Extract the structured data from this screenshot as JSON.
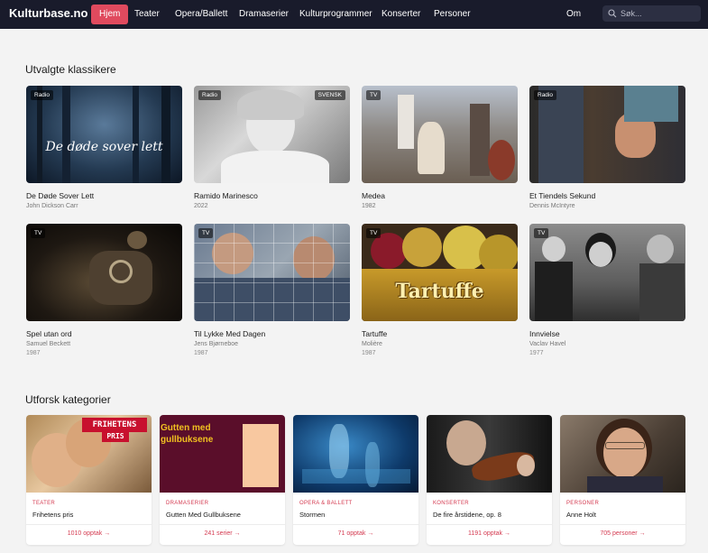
{
  "nav": {
    "brand": "Kulturbase.no",
    "items": [
      "Hjem",
      "Teater",
      "Opera/Ballett",
      "Dramaserier",
      "Kulturprogrammer",
      "Konserter",
      "Personer"
    ],
    "om": "Om",
    "search_placeholder": "Søk..."
  },
  "classics": {
    "heading": "Utvalgte klassikere",
    "items": [
      {
        "title": "De Døde Sover Lett",
        "sub": "John Dickson Carr",
        "year": "",
        "badge": "Radio",
        "badge2": "",
        "overlay": "De døde sover lett"
      },
      {
        "title": "Ramido Marinesco",
        "sub": "2022",
        "year": "",
        "badge": "Radio",
        "badge2": "SVENSK",
        "overlay": ""
      },
      {
        "title": "Medea",
        "sub": "1982",
        "year": "",
        "badge": "TV",
        "badge2": "",
        "overlay": ""
      },
      {
        "title": "Et Tiendels Sekund",
        "sub": "Dennis McIntyre",
        "year": "",
        "badge": "Radio",
        "badge2": "",
        "overlay": ""
      },
      {
        "title": "Spel utan ord",
        "sub": "Samuel Beckett",
        "year": "1987",
        "badge": "TV",
        "badge2": "",
        "overlay": ""
      },
      {
        "title": "Til Lykke Med Dagen",
        "sub": "Jens Bjørneboe",
        "year": "1987",
        "badge": "TV",
        "badge2": "",
        "overlay": ""
      },
      {
        "title": "Tartuffe",
        "sub": "Molière",
        "year": "1987",
        "badge": "TV",
        "badge2": "",
        "overlay": "Tartuffe"
      },
      {
        "title": "Innvielse",
        "sub": "Vaclav Havel",
        "year": "1977",
        "badge": "TV",
        "badge2": "",
        "overlay": ""
      }
    ]
  },
  "categories": {
    "heading": "Utforsk kategorier",
    "items": [
      {
        "kind": "TEATER",
        "name": "Frihetens pris",
        "count": "1010 opptak →",
        "overlay1": "FRIHETENS",
        "overlay2": "PRIS"
      },
      {
        "kind": "DRAMASERIER",
        "name": "Gutten Med Gullbuksene",
        "count": "241 serier →",
        "overlay1": "Gutten med",
        "overlay2": "gullbuksene"
      },
      {
        "kind": "OPERA & BALLETT",
        "name": "Stormen",
        "count": "71 opptak →",
        "overlay1": "",
        "overlay2": ""
      },
      {
        "kind": "KONSERTER",
        "name": "De fire årstidene, op. 8",
        "count": "1191 opptak →",
        "overlay1": "",
        "overlay2": ""
      },
      {
        "kind": "PERSONER",
        "name": "Anne Holt",
        "count": "705 personer →",
        "overlay1": "",
        "overlay2": ""
      }
    ]
  },
  "colors": {
    "nav_bg": "#191b2b",
    "accent": "#e04a5e",
    "category_text": "#d43a50",
    "page_bg": "#f3f3f3"
  }
}
